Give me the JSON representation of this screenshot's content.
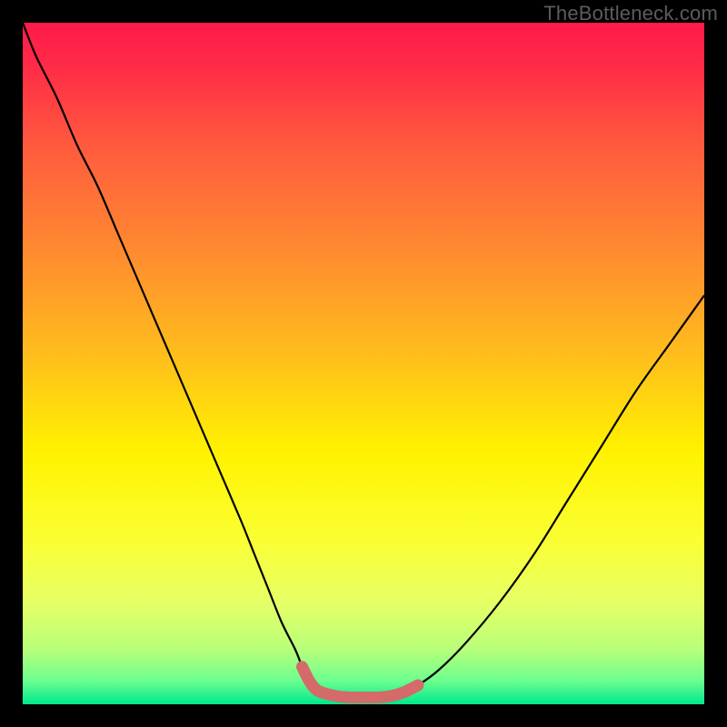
{
  "watermark": "TheBottleneck.com",
  "gradient_stops": [
    {
      "offset": 0.0,
      "color": "#ff1a48"
    },
    {
      "offset": 0.06,
      "color": "#ff2a47"
    },
    {
      "offset": 0.18,
      "color": "#ff5a3e"
    },
    {
      "offset": 0.34,
      "color": "#ff8c30"
    },
    {
      "offset": 0.5,
      "color": "#ffc21a"
    },
    {
      "offset": 0.63,
      "color": "#fff200"
    },
    {
      "offset": 0.76,
      "color": "#faff33"
    },
    {
      "offset": 0.85,
      "color": "#e6ff66"
    },
    {
      "offset": 0.92,
      "color": "#b7ff7a"
    },
    {
      "offset": 0.965,
      "color": "#6dff8f"
    },
    {
      "offset": 1.0,
      "color": "#00e88c"
    }
  ],
  "curve_color": "#000000",
  "highlight_color": "#d46a6a",
  "chart_data": {
    "type": "line",
    "title": "",
    "xlabel": "",
    "ylabel": "",
    "xlim": [
      0,
      100
    ],
    "ylim": [
      0,
      100
    ],
    "series": [
      {
        "name": "bottleneck-curve",
        "x": [
          0,
          2,
          5,
          8,
          11,
          14,
          17,
          20,
          23,
          26,
          29,
          32,
          34,
          36,
          38,
          40,
          41,
          42,
          43,
          44,
          46,
          48,
          50,
          52,
          54,
          56,
          58,
          61,
          65,
          70,
          75,
          80,
          85,
          90,
          95,
          100
        ],
        "y": [
          100,
          95,
          89,
          82,
          76,
          69,
          62,
          55,
          48,
          41,
          34,
          27,
          22,
          17,
          12,
          8,
          5.5,
          3.5,
          2.2,
          1.7,
          1.2,
          1.0,
          1.0,
          1.0,
          1.2,
          1.8,
          2.8,
          5,
          9,
          15,
          22,
          30,
          38,
          46,
          53,
          60
        ]
      }
    ],
    "highlight_segment": {
      "x_start": 41,
      "x_end": 58
    }
  }
}
